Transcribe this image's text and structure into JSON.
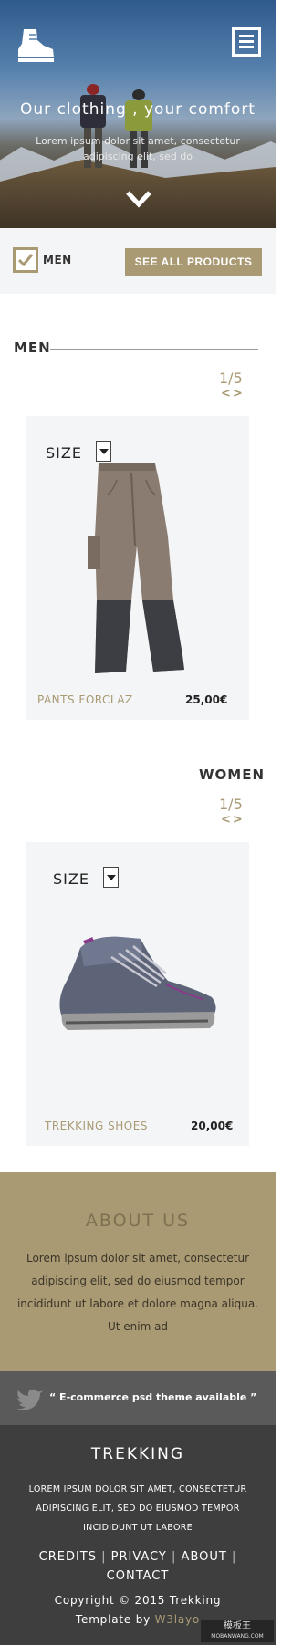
{
  "hero": {
    "title": "Our clothing , your comfort",
    "subtitle": "Lorem ipsum dolor sit amet, consectetur adipiscing elit, sed do"
  },
  "filter": {
    "label": "MEN",
    "see_all": "SEE ALL PRODUCTS",
    "checked": true
  },
  "sections": [
    {
      "label": "MEN",
      "pager": "1/5",
      "arrows": "<>",
      "size_label": "SIZE",
      "product_name": "PANTS FORCLAZ",
      "price": "25,00€"
    },
    {
      "label": "WOMEN",
      "pager": "1/5",
      "arrows": "<>",
      "size_label": "SIZE",
      "product_name": "TREKKING SHOES",
      "price": "20,00€"
    }
  ],
  "about": {
    "title": "ABOUT US",
    "text": "Lorem ipsum dolor sit amet, consectetur adipiscing elit, sed do eiusmod tempor incididunt ut labore et dolore magna aliqua. Ut enim ad"
  },
  "tweet": {
    "text": "“ E-commerce psd theme available ”"
  },
  "footer": {
    "brand": "TREKKING",
    "description": "LOREM IPSUM DOLOR SIT AMET, CONSECTETUR ADIPISCING ELIT, SED DO EIUSMOD TEMPOR INCIDIDUNT UT LABORE",
    "links": [
      "CREDITS",
      "PRIVACY",
      "ABOUT",
      "CONTACT"
    ],
    "copyright": "Copyright © 2015 Trekking",
    "template_by_prefix": "Template by",
    "template_by": "W3layo"
  },
  "watermark": {
    "line1": "模板王",
    "line2": "MOBANWANG.COM"
  },
  "colors": {
    "accent": "#a99a74",
    "panel": "#f4f5f7",
    "footer": "#3e3e3e",
    "tweet_bar": "#5a5a5a"
  }
}
